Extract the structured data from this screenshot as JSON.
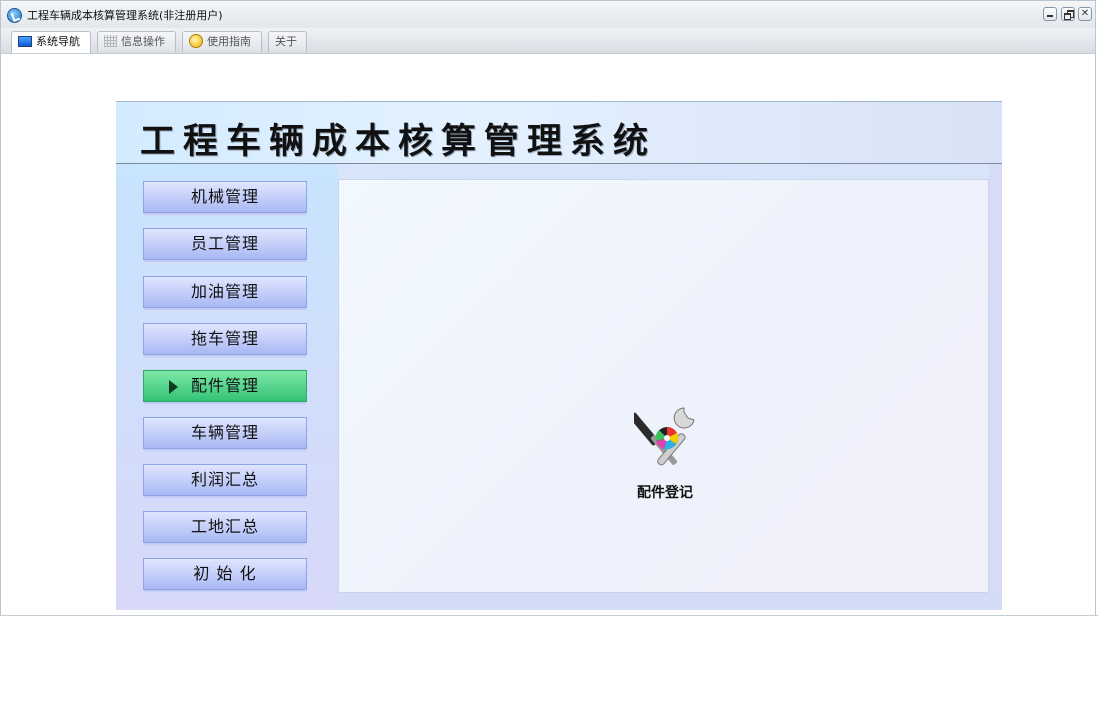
{
  "window": {
    "title": "工程车辆成本核算管理系统(非注册用户)"
  },
  "tabs": [
    {
      "label": "系统导航",
      "icon": "navigation-icon",
      "active": true
    },
    {
      "label": "信息操作",
      "icon": "grid-icon",
      "active": false
    },
    {
      "label": "使用指南",
      "icon": "guide-icon",
      "active": false
    },
    {
      "label": "关于",
      "icon": "",
      "active": false
    }
  ],
  "banner": {
    "title": "工程车辆成本核算管理系统"
  },
  "sidebar": {
    "items": [
      {
        "label": "机械管理"
      },
      {
        "label": "员工管理"
      },
      {
        "label": "加油管理"
      },
      {
        "label": "拖车管理"
      },
      {
        "label": "配件管理",
        "active": true
      },
      {
        "label": "车辆管理"
      },
      {
        "label": "利润汇总"
      },
      {
        "label": "工地汇总"
      },
      {
        "label": "初 始 化"
      }
    ]
  },
  "main": {
    "items": [
      {
        "label": "配件登记",
        "icon": "tools-icon"
      }
    ]
  },
  "colors": {
    "active_nav": "#33c377",
    "nav_button": "#a9b8f4",
    "banner_bg": "#d3ebff"
  }
}
